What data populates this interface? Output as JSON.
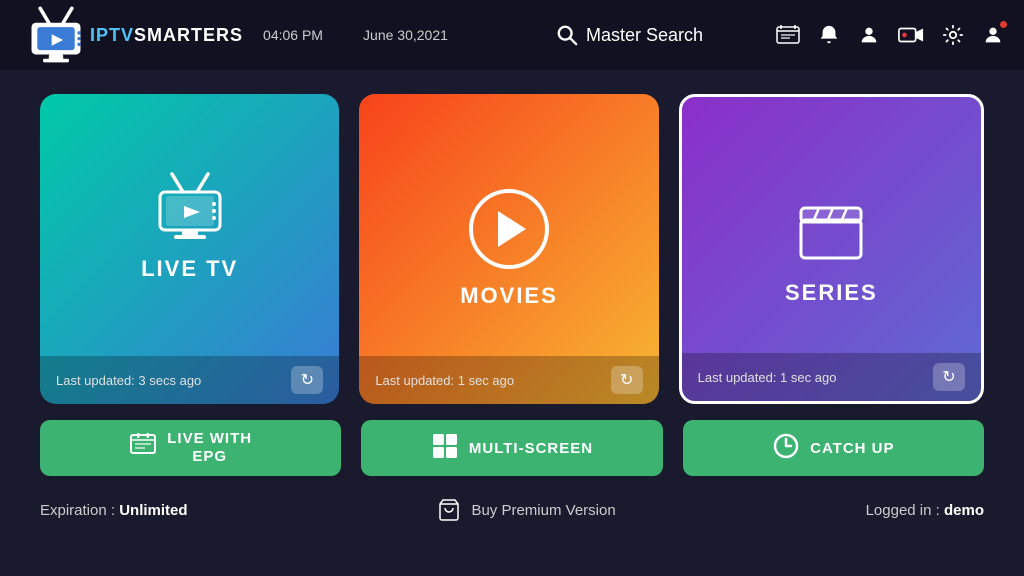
{
  "header": {
    "logo_iptv": "IPTV",
    "logo_smarters": "SMARTERS",
    "time": "04:06 PM",
    "date": "June 30,2021",
    "search_label": "Master Search",
    "icons": [
      "epg-icon",
      "bell-icon",
      "user-icon",
      "rec-icon",
      "settings-icon",
      "profile-icon"
    ]
  },
  "cards": {
    "live_tv": {
      "title": "LIVE TV",
      "last_updated": "Last updated: 3 secs ago"
    },
    "movies": {
      "title": "MOVIES",
      "last_updated": "Last updated: 1 sec ago"
    },
    "series": {
      "title": "SERIES",
      "last_updated": "Last updated: 1 sec ago"
    }
  },
  "bottom_buttons": {
    "live_epg": "LIVE WITH\nEPG",
    "live_epg_line1": "LIVE WITH",
    "live_epg_line2": "EPG",
    "multi_screen": "MULTI-SCREEN",
    "catch_up": "CATCH UP"
  },
  "footer": {
    "expiration_label": "Expiration :",
    "expiration_value": "Unlimited",
    "buy_label": "Buy Premium Version",
    "logged_in_label": "Logged in :",
    "logged_in_value": "demo"
  }
}
